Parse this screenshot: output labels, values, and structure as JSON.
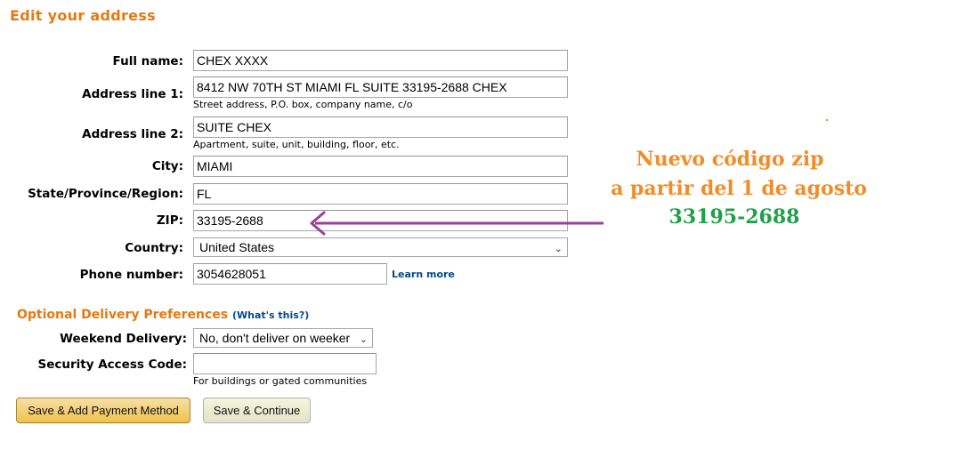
{
  "page": {
    "title": "Edit your address"
  },
  "form": {
    "full_name": {
      "label": "Full name:",
      "value": "CHEX XXXX"
    },
    "address1": {
      "label": "Address line 1:",
      "value": "8412 NW 70TH ST MIAMI FL SUITE 33195-2688 CHEX",
      "hint": "Street address, P.O. box, company name, c/o"
    },
    "address2": {
      "label": "Address line 2:",
      "value": "SUITE CHEX",
      "hint": "Apartment, suite, unit, building, floor, etc."
    },
    "city": {
      "label": "City:",
      "value": "MIAMI"
    },
    "state": {
      "label": "State/Province/Region:",
      "value": "FL"
    },
    "zip": {
      "label": "ZIP:",
      "value": "33195-2688"
    },
    "country": {
      "label": "Country:",
      "value": "United States"
    },
    "phone": {
      "label": "Phone number:",
      "value": "3054628051",
      "learn_more": "Learn more"
    }
  },
  "delivery": {
    "heading": "Optional Delivery Preferences",
    "whats_this": "What's this?",
    "weekend": {
      "label": "Weekend Delivery:",
      "value": "No, don't deliver on weeker"
    },
    "security": {
      "label": "Security Access Code:",
      "value": "",
      "hint": "For buildings or gated communities"
    }
  },
  "buttons": {
    "save_payment": "Save & Add Payment Method",
    "save_continue": "Save & Continue"
  },
  "annotation": {
    "line1": "Nuevo código zip",
    "line2": "a partir del 1 de agosto",
    "line3": "33195-2688",
    "colors": {
      "text": "#f28c28",
      "zip": "#21a04a",
      "arrow": "#9b3f9b"
    }
  },
  "colors": {
    "accent": "#e47911",
    "link": "#004b91"
  }
}
